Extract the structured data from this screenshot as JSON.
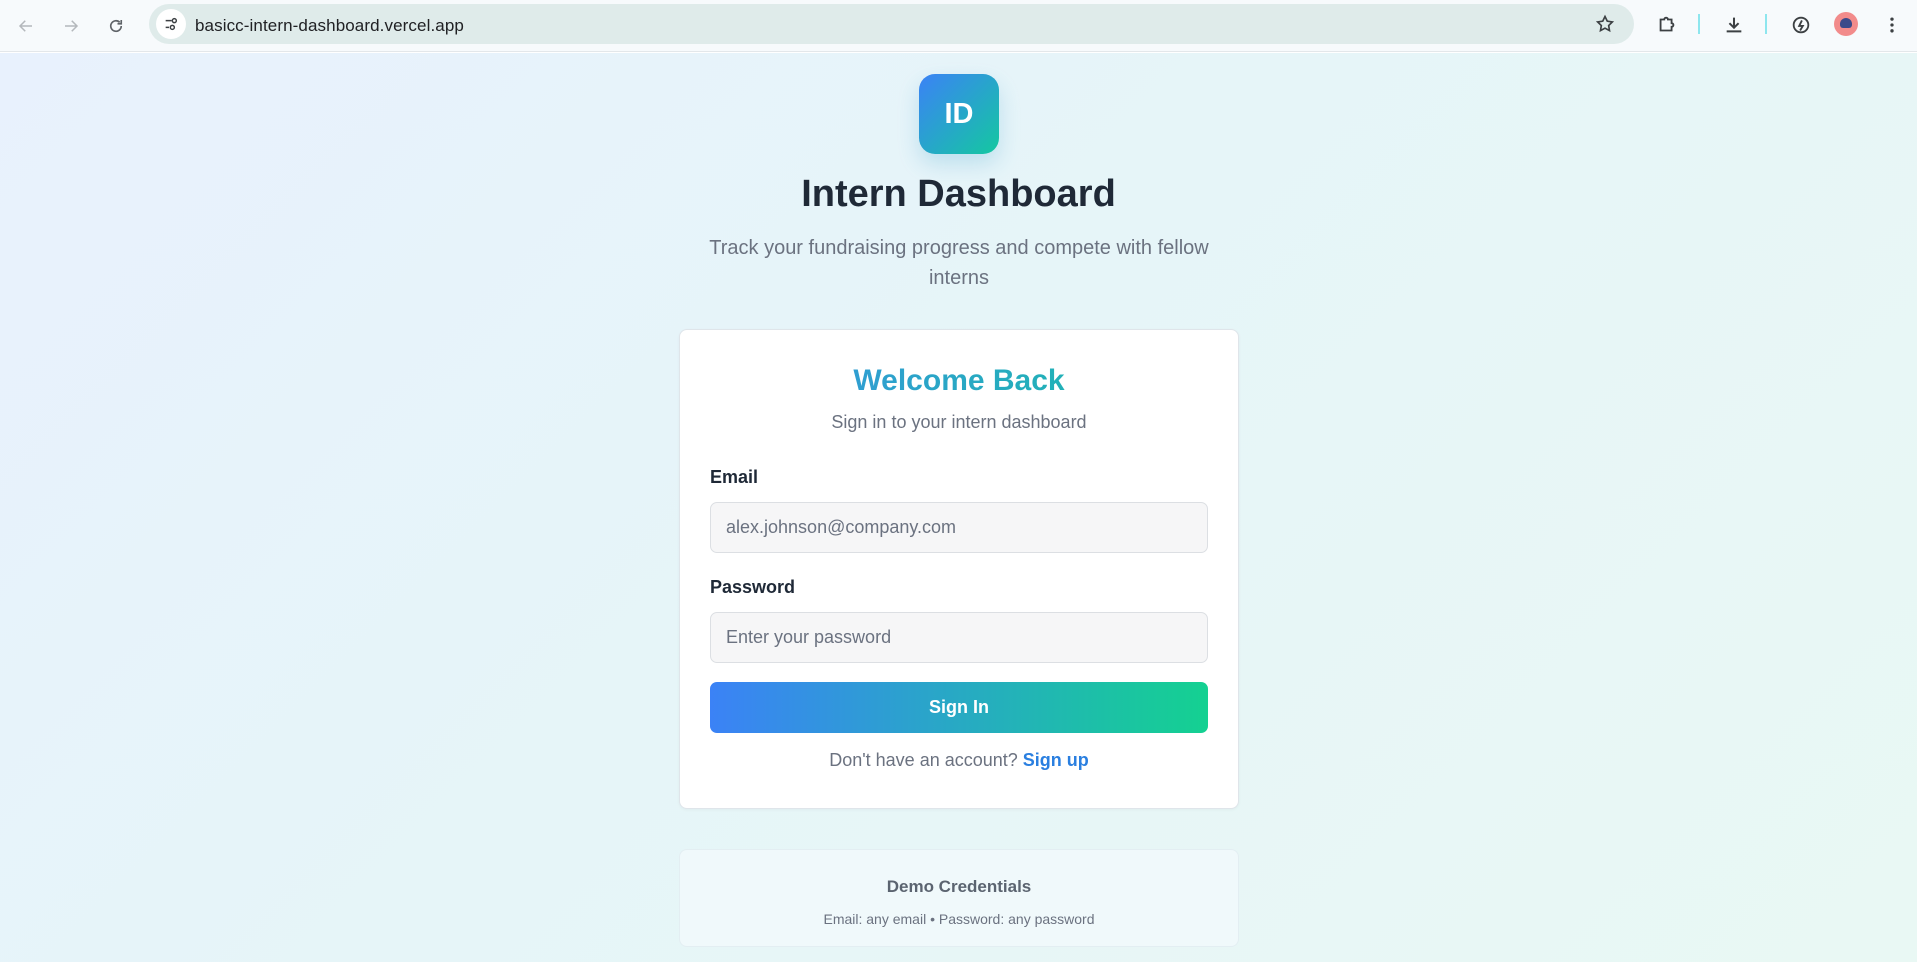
{
  "browser": {
    "url": "basicc-intern-dashboard.vercel.app",
    "icons": {
      "back": "arrow-left-icon",
      "forward": "arrow-right-icon",
      "reload": "reload-icon",
      "site_info": "tune-icon",
      "bookmark": "star-icon",
      "extensions": "puzzle-icon",
      "downloads": "download-icon",
      "performance": "speed-icon",
      "menu": "kebab-menu-icon"
    }
  },
  "header": {
    "logo_text": "ID",
    "title": "Intern Dashboard",
    "subtitle": "Track your fundraising progress and compete with fellow interns"
  },
  "login": {
    "title": "Welcome Back",
    "subtitle": "Sign in to your intern dashboard",
    "email_label": "Email",
    "email_placeholder": "alex.johnson@company.com",
    "password_label": "Password",
    "password_placeholder": "Enter your password",
    "submit_label": "Sign In",
    "signup_prompt": "Don't have an account?",
    "signup_link": "Sign up"
  },
  "demo": {
    "title": "Demo Credentials",
    "text": "Email: any email • Password: any password"
  },
  "colors": {
    "gradient_start": "#3b82f6",
    "gradient_end": "#14d191",
    "link": "#2a7fe0",
    "heading": "#1f2937",
    "muted": "#6b7280"
  }
}
